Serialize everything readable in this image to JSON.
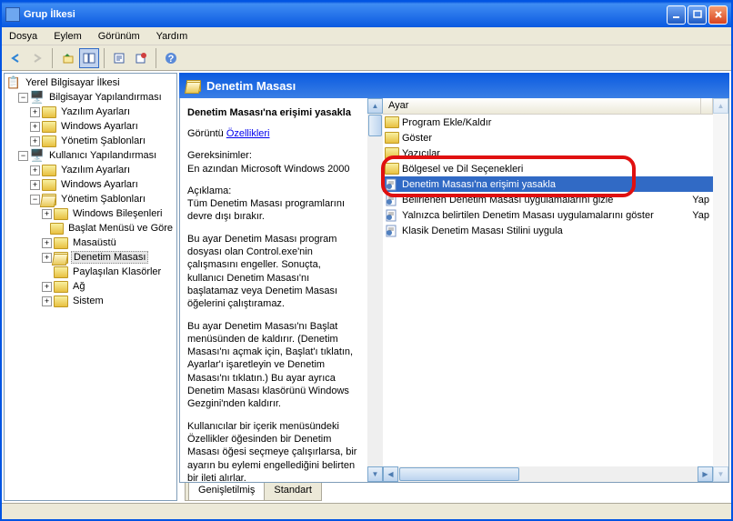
{
  "window": {
    "title": "Grup İlkesi"
  },
  "menu": {
    "items": [
      "Dosya",
      "Eylem",
      "Görünüm",
      "Yardım"
    ]
  },
  "tree": {
    "root": "Yerel Bilgisayar İlkesi",
    "n": [
      {
        "label": "Bilgisayar Yapılandırması",
        "lvl": 1,
        "exp": "-",
        "icon": "r"
      },
      {
        "label": "Yazılım Ayarları",
        "lvl": 2,
        "exp": "+",
        "icon": "f"
      },
      {
        "label": "Windows Ayarları",
        "lvl": 2,
        "exp": "+",
        "icon": "f"
      },
      {
        "label": "Yönetim Şablonları",
        "lvl": 2,
        "exp": "+",
        "icon": "f"
      },
      {
        "label": "Kullanıcı Yapılandırması",
        "lvl": 1,
        "exp": "-",
        "icon": "r"
      },
      {
        "label": "Yazılım Ayarları",
        "lvl": 2,
        "exp": "+",
        "icon": "f"
      },
      {
        "label": "Windows Ayarları",
        "lvl": 2,
        "exp": "+",
        "icon": "f"
      },
      {
        "label": "Yönetim Şablonları",
        "lvl": 2,
        "exp": "-",
        "icon": "o"
      },
      {
        "label": "Windows Bileşenleri",
        "lvl": 3,
        "exp": "+",
        "icon": "f"
      },
      {
        "label": "Başlat Menüsü ve Göre",
        "lvl": 3,
        "exp": "",
        "icon": "f"
      },
      {
        "label": "Masaüstü",
        "lvl": 3,
        "exp": "+",
        "icon": "f"
      },
      {
        "label": "Denetim Masası",
        "lvl": 3,
        "exp": "+",
        "icon": "o",
        "sel": true
      },
      {
        "label": "Paylaşılan Klasörler",
        "lvl": 3,
        "exp": "",
        "icon": "f"
      },
      {
        "label": "Ağ",
        "lvl": 3,
        "exp": "+",
        "icon": "f"
      },
      {
        "label": "Sistem",
        "lvl": 3,
        "exp": "+",
        "icon": "f"
      }
    ]
  },
  "main": {
    "title": "Denetim Masası",
    "heading": "Denetim Masası'na erişimi yasakla",
    "links": {
      "display": "Görüntü",
      "props": "Özellikleri"
    },
    "req_label": "Gereksinimler:",
    "req_text": "En azından Microsoft Windows 2000",
    "desc_label": "Açıklama:",
    "desc1": "Tüm Denetim Masası programlarını devre dışı bırakır.",
    "desc2": "Bu ayar Denetim Masası program dosyası olan Control.exe'nin çalışmasını engeller. Sonuçta, kullanıcı Denetim Masası'nı başlatamaz veya Denetim Masası öğelerini çalıştıramaz.",
    "desc3": "Bu ayar Denetim Masası'nı Başlat menüsünden de kaldırır. (Denetim Masası'nı açmak için, Başlat'ı tıklatın, Ayarlar'ı işaretleyin ve Denetim Masası'nı tıklatın.) Bu ayar ayrıca Denetim Masası klasörünü Windows Gezgini'nden kaldırır.",
    "desc4": "Kullanıcılar bir içerik menüsündeki Özellikler öğesinden bir Denetim Masası öğesi seçmeye çalışırlarsa, bir ayarın bu eylemi engellediğini belirten bir ileti alırlar."
  },
  "list": {
    "col": "Ayar",
    "col2r": "Yap",
    "col2r2": "Yap",
    "items": [
      {
        "label": "Program Ekle/Kaldır",
        "icon": "f"
      },
      {
        "label": "Göster",
        "icon": "f"
      },
      {
        "label": "Yazıcılar",
        "icon": "f"
      },
      {
        "label": "Bölgesel ve Dil Seçenekleri",
        "icon": "f"
      },
      {
        "label": "Denetim Masası'na erişimi yasakla",
        "icon": "p",
        "sel": true
      },
      {
        "label": "Belirlenen Denetim Masası uygulamalarını gizle",
        "icon": "p"
      },
      {
        "label": "Yalnızca belirtilen Denetim Masası uygulamalarını göster",
        "icon": "p"
      },
      {
        "label": "Klasik Denetim Masası Stilini uygula",
        "icon": "p"
      }
    ]
  },
  "tabs": {
    "a": "Genişletilmiş",
    "b": "Standart"
  }
}
